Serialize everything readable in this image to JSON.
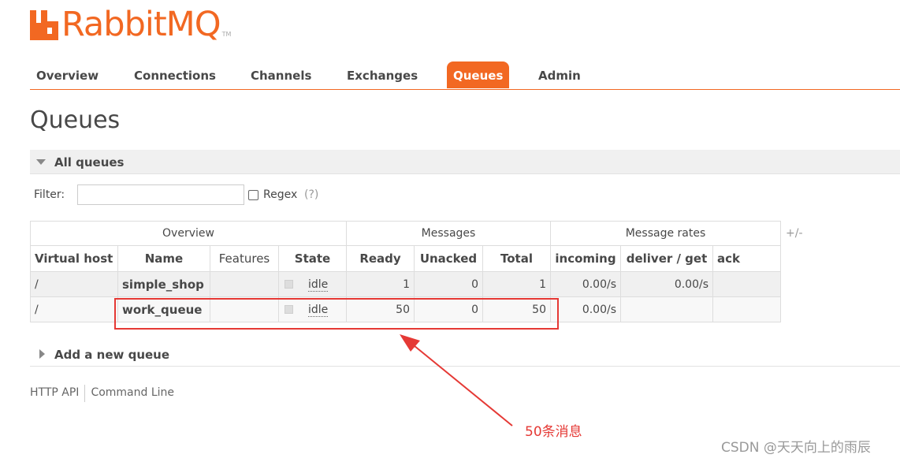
{
  "brand": {
    "logo_text": "RabbitMQ",
    "tm": "TM",
    "color": "#f26822"
  },
  "tabs": [
    {
      "label": "Overview",
      "active": false
    },
    {
      "label": "Connections",
      "active": false
    },
    {
      "label": "Channels",
      "active": false
    },
    {
      "label": "Exchanges",
      "active": false
    },
    {
      "label": "Queues",
      "active": true
    },
    {
      "label": "Admin",
      "active": false
    }
  ],
  "page_title": "Queues",
  "section": {
    "title": "All queues",
    "icon": "triangle-down-icon"
  },
  "filter": {
    "label": "Filter:",
    "value": "",
    "regex_label": "Regex",
    "regex_help": "(?)",
    "regex_checked": false
  },
  "table": {
    "groups": [
      "Overview",
      "Messages",
      "Message rates"
    ],
    "columns": [
      "Virtual host",
      "Name",
      "Features",
      "State",
      "Ready",
      "Unacked",
      "Total",
      "incoming",
      "deliver / get",
      "ack"
    ],
    "plus_minus": "+/-",
    "rows": [
      {
        "vhost": "/",
        "name": "simple_shop",
        "features": "",
        "state": "idle",
        "ready": "1",
        "unacked": "0",
        "total": "1",
        "incoming": "0.00/s",
        "deliver_get": "0.00/s",
        "ack": ""
      },
      {
        "vhost": "/",
        "name": "work_queue",
        "features": "",
        "state": "idle",
        "ready": "50",
        "unacked": "0",
        "total": "50",
        "incoming": "0.00/s",
        "deliver_get": "",
        "ack": ""
      }
    ]
  },
  "add_queue": {
    "label": "Add a new queue",
    "icon": "triangle-right-icon"
  },
  "footer": {
    "http_api": "HTTP API",
    "command_line": "Command Line"
  },
  "annotation": {
    "text": "50条消息",
    "color": "#e53935"
  },
  "watermark": "CSDN @天天向上的雨辰"
}
